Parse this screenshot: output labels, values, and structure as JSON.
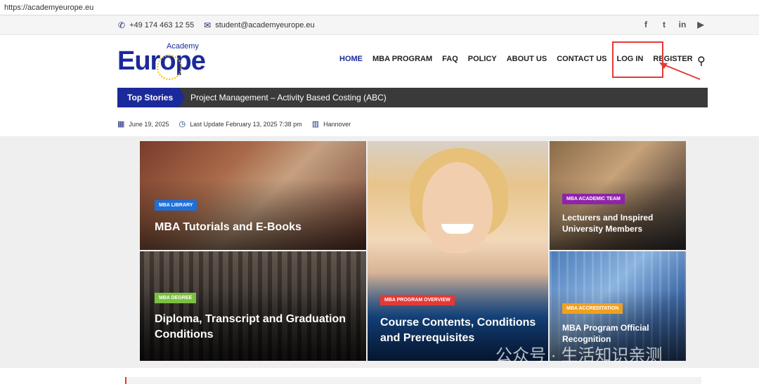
{
  "browser": {
    "url": "https://academyeurope.eu"
  },
  "topbar": {
    "phone": "+49 174 463 12 55",
    "email": "student@academyeurope.eu",
    "social_icons": [
      "facebook-icon",
      "twitter-icon",
      "linkedin-icon",
      "youtube-icon"
    ]
  },
  "logo": {
    "small": "Academy",
    "main": "Europe"
  },
  "nav": {
    "items": [
      {
        "label": "HOME",
        "active": true
      },
      {
        "label": "MBA PROGRAM"
      },
      {
        "label": "FAQ"
      },
      {
        "label": "POLICY"
      },
      {
        "label": "ABOUT US"
      },
      {
        "label": "CONTACT US"
      },
      {
        "label": "LOG IN"
      },
      {
        "label": "REGISTER"
      }
    ]
  },
  "ticker": {
    "label": "Top Stories",
    "headline": "Project Management – Activity Based Costing (ABC)"
  },
  "meta": {
    "date": "June 19, 2025",
    "last_update": "Last Update February 13, 2025 7:38 pm",
    "location": "Hannover"
  },
  "tiles": [
    {
      "badge": "MBA LIBRARY",
      "badge_color": "#1e6fd9",
      "title": "MBA Tutorials and E-Books"
    },
    {
      "badge": "MBA DEGREE",
      "badge_color": "#7cc043",
      "title": "Diploma, Transcript and Graduation Conditions"
    },
    {
      "badge": "MBA PROGRAM OVERVIEW",
      "badge_color": "#e53935",
      "title": "Course Contents, Conditions and Prerequisites"
    },
    {
      "badge": "MBA ACADEMIC TEAM",
      "badge_color": "#8e24aa",
      "title": "Lecturers and Inspired University Members"
    },
    {
      "badge": "MBA ACCREDITATION",
      "badge_color": "#f0a020",
      "title": "MBA Program Official Recognition"
    }
  ],
  "watermark": "公众号 · 生活知识亲测"
}
